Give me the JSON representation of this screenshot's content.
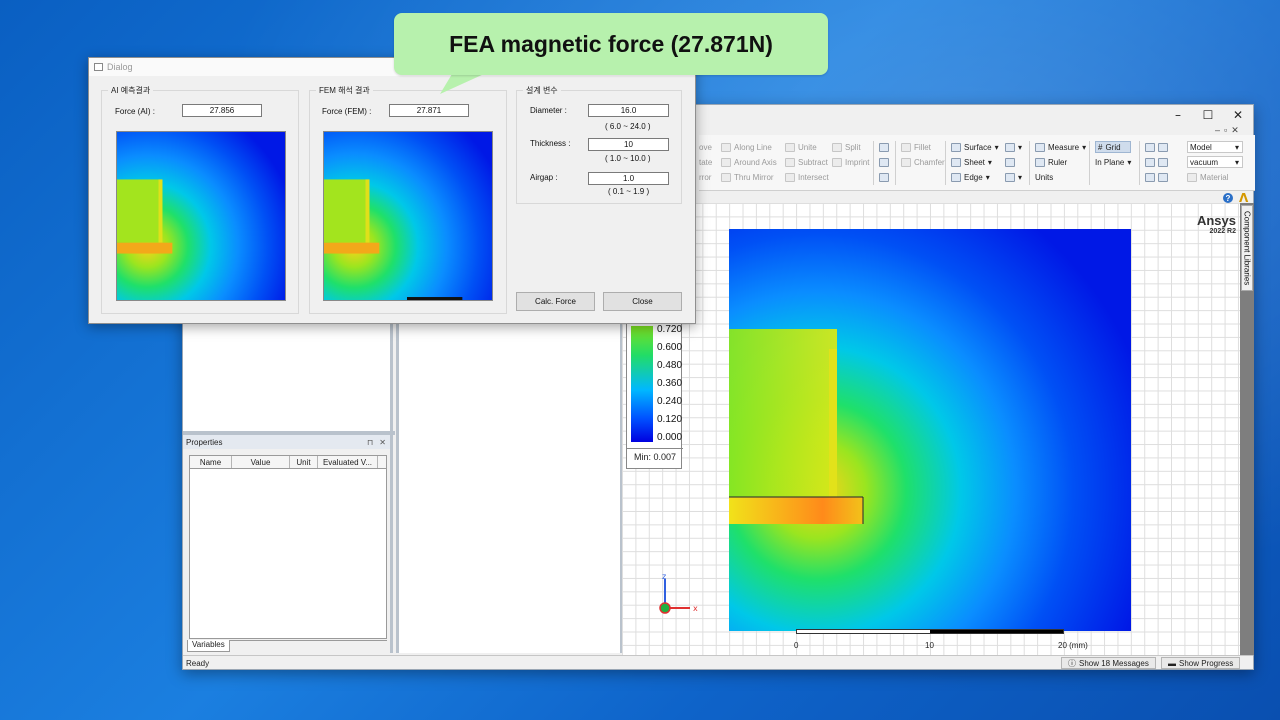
{
  "app": {
    "window_controls": [
      "–",
      "☐",
      "✕"
    ],
    "mdi_controls": [
      "–",
      "▫",
      "✕"
    ],
    "ribbon": {
      "col1": [
        "ove",
        "tate",
        "rror"
      ],
      "col2": [
        "Along Line",
        "Around Axis",
        "Thru Mirror"
      ],
      "col3": [
        "Unite",
        "Subtract",
        "Intersect"
      ],
      "col4": [
        "Split",
        "Imprint"
      ],
      "col6": [
        "Fillet",
        "Chamfer"
      ],
      "col7": [
        "Surface",
        "Sheet",
        "Edge"
      ],
      "col9": [
        "Measure",
        "Ruler",
        "Units"
      ],
      "col10": [
        "Grid",
        "In Plane"
      ],
      "combo_model": "Model",
      "combo_material": "vacuum",
      "material_label": "Material"
    },
    "help_icon": "?",
    "ansys_small": "Λ",
    "properties": {
      "title": "Properties",
      "pin": "⊓",
      "close": "✕",
      "columns": [
        "Name",
        "Value",
        "Unit",
        "Evaluated V..."
      ],
      "tab": "Variables"
    },
    "viewport": {
      "brand": "Ansys",
      "version": "2022 R2",
      "legend": {
        "labels": [
          "0.720",
          "0.600",
          "0.480",
          "0.360",
          "0.240",
          "0.120",
          "0.000"
        ],
        "min_text": "Min: 0.007"
      },
      "scale_labels": [
        "0",
        "10",
        "20 (mm)"
      ],
      "axis_labels": {
        "z": "z",
        "x": "x"
      }
    },
    "side_tab": "Component Libraries",
    "status": {
      "ready": "Ready",
      "messages_btn": "Show 18 Messages",
      "progress_btn": "Show Progress"
    }
  },
  "dialog": {
    "title": "Dialog",
    "ai_group": {
      "title": "AI 예측결과",
      "force_label": "Force (AI) :",
      "force_value": "27.856"
    },
    "fem_group": {
      "title": "FEM 해석 결과",
      "force_label": "Force (FEM) :",
      "force_value": "27.871"
    },
    "design_group": {
      "title": "설계 변수",
      "diameter_label": "Diameter :",
      "diameter_value": "16.0",
      "diameter_range": "( 6.0 ~ 24.0 )",
      "thickness_label": "Thickness :",
      "thickness_value": "10",
      "thickness_range": "( 1.0 ~ 10.0 )",
      "airgap_label": "Airgap :",
      "airgap_value": "1.0",
      "airgap_range": "( 0.1 ~ 1.9 )"
    },
    "calc_button": "Calc. Force",
    "close_button": "Close"
  },
  "callout": {
    "text": "FEA magnetic force (27.871N)"
  },
  "colors": {
    "callout_bg": "#b7f1ad",
    "desktop": "#1b7fe0",
    "field_low": "#0000e0",
    "field_high": "#ffd21a"
  }
}
